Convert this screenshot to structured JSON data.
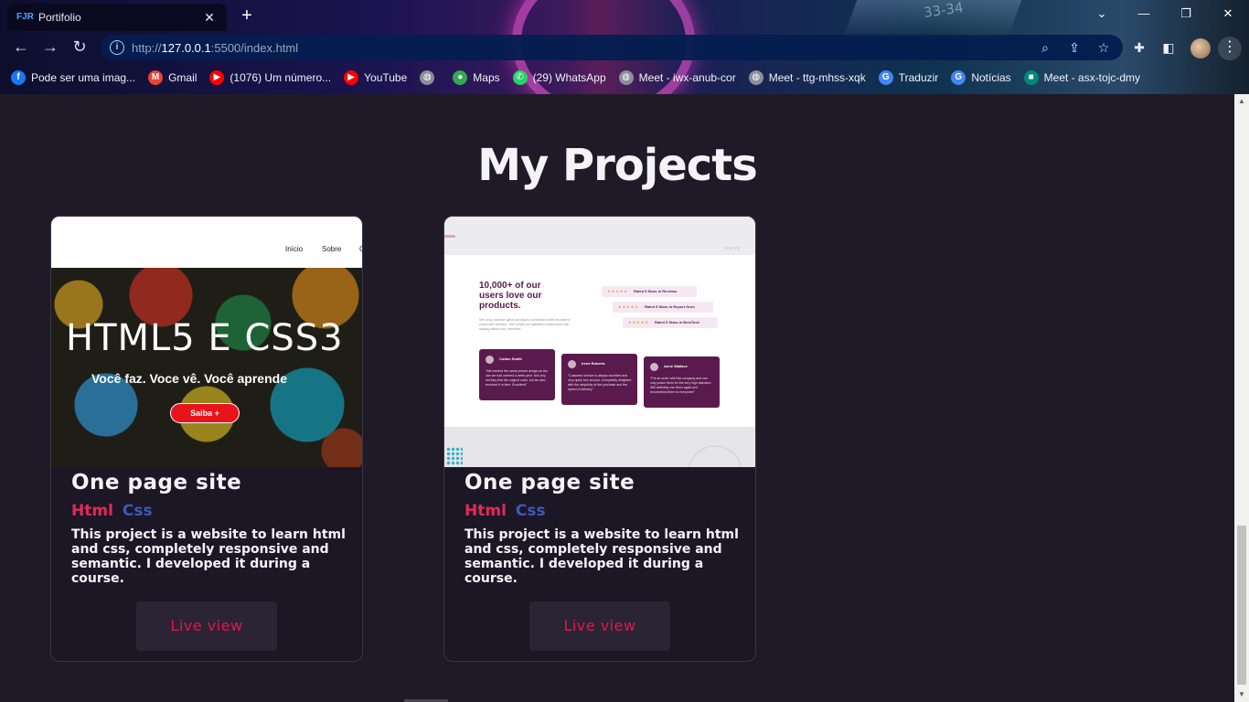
{
  "browser": {
    "tab_title": "Portifolio",
    "tab_favicon": "FJR",
    "url_prefix": "http://",
    "url_host": "127.0.0.1",
    "url_rest": ":5500/index.html",
    "window_controls": [
      "chevron-down",
      "minimize",
      "restore",
      "close"
    ]
  },
  "bookmarks": [
    {
      "label": "Pode ser uma imag...",
      "icon": "facebook",
      "color": "#1877f2",
      "glyph": "f"
    },
    {
      "label": "Gmail",
      "icon": "gmail",
      "color": "#ea4335",
      "glyph": "M"
    },
    {
      "label": "(1076) Um número...",
      "icon": "youtube",
      "color": "#ff0000",
      "glyph": "▶"
    },
    {
      "label": "YouTube",
      "icon": "youtube",
      "color": "#ff0000",
      "glyph": "▶"
    },
    {
      "label": "",
      "icon": "globe",
      "color": "#8a8f9a",
      "glyph": "◍"
    },
    {
      "label": "Maps",
      "icon": "maps",
      "color": "#34a853",
      "glyph": "●"
    },
    {
      "label": "(29) WhatsApp",
      "icon": "whatsapp",
      "color": "#25d366",
      "glyph": "✆"
    },
    {
      "label": "Meet - iwx-anub-cor",
      "icon": "globe",
      "color": "#8a8f9a",
      "glyph": "◍"
    },
    {
      "label": "Meet - ttg-mhss-xqk",
      "icon": "globe",
      "color": "#8a8f9a",
      "glyph": "◍"
    },
    {
      "label": "Traduzir",
      "icon": "translate",
      "color": "#4285f4",
      "glyph": "G"
    },
    {
      "label": "Notícias",
      "icon": "news",
      "color": "#4285f4",
      "glyph": "G"
    },
    {
      "label": "Meet - asx-tojc-dmy",
      "icon": "meet",
      "color": "#00897b",
      "glyph": "■"
    }
  ],
  "page": {
    "section_title": "My Projects",
    "projects": [
      {
        "title": "One page site",
        "tags": [
          "Html",
          "Css"
        ],
        "description": "This project is a website to learn html and css, completely responsive and semantic. I developed it during a course.",
        "button": "Live view",
        "thumb": {
          "nav": [
            "Início",
            "Sobre",
            "C"
          ],
          "heading": "HTML5 E CSS3",
          "subheading": "Você faz. Voce vê. Você aprende",
          "button": "Saiba +"
        }
      },
      {
        "title": "One page site",
        "tags": [
          "Html",
          "Css"
        ],
        "description": "This project is a website to learn html and css, completely responsive and semantic. I developed it during a course.",
        "button": "Live view",
        "thumb": {
          "heading": "10,000+ of our users love our products.",
          "paragraph": "We only provide great products combined with excellent customer service. See what our satisfied customers are saying about our services.",
          "ratings": [
            "Rated 5 Stars in Reviews",
            "Rated 5 Stars in Report Guru",
            "Rated 5 Stars in BestTech"
          ],
          "stars": "★★★★★",
          "testimonials": [
            {
              "name": "Colton Smith",
              "text": "\"We needed the same printed design as the one we had ordered a week prior. Not only did they find the original order, but we also received it in time. Excellent!\""
            },
            {
              "name": "Irene Roberts",
              "text": "\"Customer service is always excellent and very quick turn around. Completely delighted with the simplicity of the purchase and the speed of delivery.\""
            },
            {
              "name": "Anne Wallace",
              "text": "\"Put an order with this company and can only praise them for the very high standard. Will definitely use them again and recommend them to everyone!\""
            }
          ]
        }
      }
    ]
  }
}
